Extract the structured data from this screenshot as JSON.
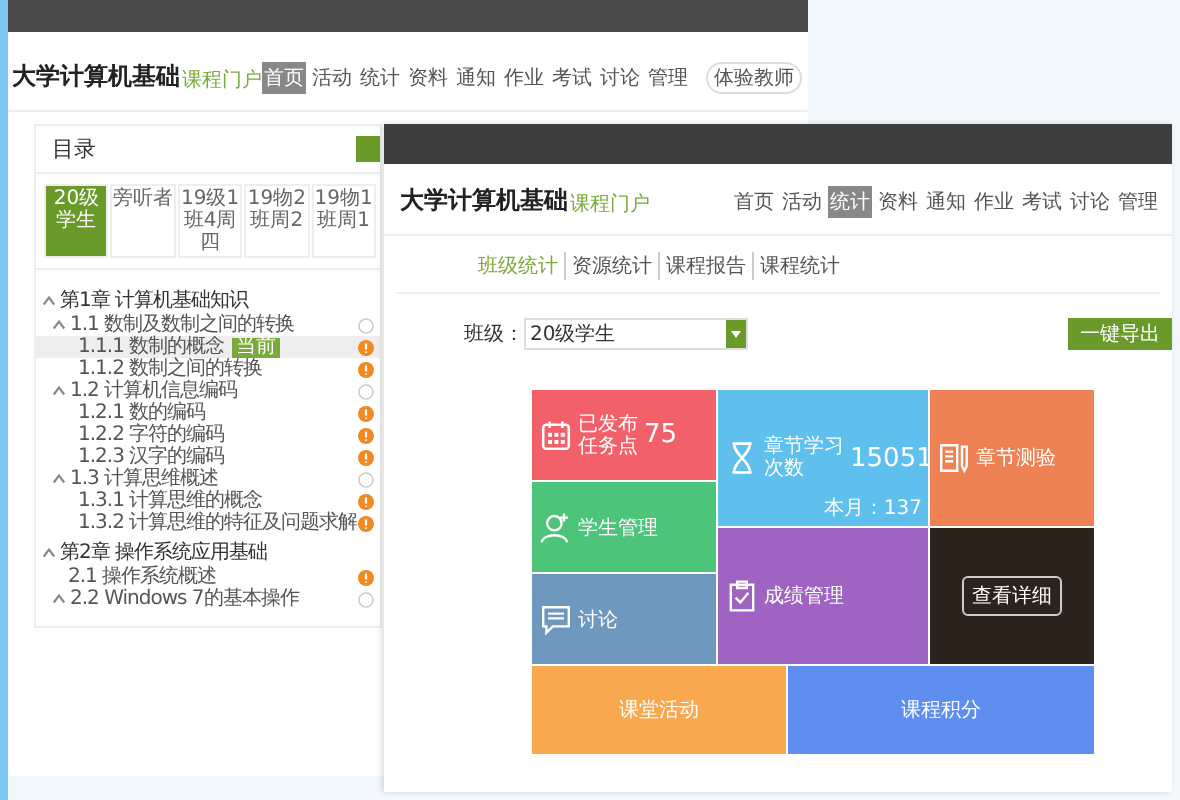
{
  "back_window": {
    "course_title": "大学计算机基础",
    "portal_label": "课程门户",
    "nav": [
      {
        "label": "首页",
        "selected": true
      },
      {
        "label": "活动",
        "selected": false
      },
      {
        "label": "统计",
        "selected": false
      },
      {
        "label": "资料",
        "selected": false
      },
      {
        "label": "通知",
        "selected": false
      },
      {
        "label": "作业",
        "selected": false
      },
      {
        "label": "考试",
        "selected": false
      },
      {
        "label": "讨论",
        "selected": false
      },
      {
        "label": "管理",
        "selected": false
      }
    ],
    "header_button": "体验教师",
    "catalog": {
      "title": "目录",
      "tabs": [
        {
          "label": "20级学生",
          "selected": true
        },
        {
          "label": "旁听者",
          "selected": false
        },
        {
          "label": "19级1班4周四",
          "selected": false
        },
        {
          "label": "19物2班周2",
          "selected": false
        },
        {
          "label": "19物1班周1",
          "selected": false
        }
      ],
      "tree": [
        {
          "label": "第1章 计算机基础知识",
          "expanded": true,
          "children": [
            {
              "label": "1.1 数制及数制之间的转换",
              "expanded": true,
              "task": false,
              "children": [
                {
                  "label": "1.1.1 数制的概念",
                  "selected": true,
                  "task": true,
                  "badge": "当前"
                },
                {
                  "label": "1.1.2 数制之间的转换",
                  "selected": false,
                  "task": true
                }
              ]
            },
            {
              "label": "1.2 计算机信息编码",
              "expanded": true,
              "task": false,
              "children": [
                {
                  "label": "1.2.1 数的编码",
                  "selected": false,
                  "task": true
                },
                {
                  "label": "1.2.2 字符的编码",
                  "selected": false,
                  "task": true
                },
                {
                  "label": "1.2.3 汉字的编码",
                  "selected": false,
                  "task": true
                }
              ]
            },
            {
              "label": "1.3 计算思维概述",
              "expanded": true,
              "task": false,
              "children": [
                {
                  "label": "1.3.1 计算思维的概念",
                  "selected": false,
                  "task": true
                },
                {
                  "label": "1.3.2 计算思维的特征及问题求解",
                  "selected": false,
                  "task": true
                }
              ]
            }
          ]
        },
        {
          "label": "第2章 操作系统应用基础",
          "expanded": true,
          "children": [
            {
              "label": "2.1 操作系统概述",
              "selected": false,
              "task": true
            },
            {
              "label": "2.2 Windows 7的基本操作",
              "expanded": true,
              "task": false
            }
          ]
        }
      ]
    }
  },
  "front_window": {
    "course_title": "大学计算机基础",
    "portal_label": "课程门户",
    "nav": [
      {
        "label": "首页",
        "selected": false
      },
      {
        "label": "活动",
        "selected": false
      },
      {
        "label": "统计",
        "selected": true
      },
      {
        "label": "资料",
        "selected": false
      },
      {
        "label": "通知",
        "selected": false
      },
      {
        "label": "作业",
        "selected": false
      },
      {
        "label": "考试",
        "selected": false
      },
      {
        "label": "讨论",
        "selected": false
      },
      {
        "label": "管理",
        "selected": false
      }
    ],
    "subtabs": [
      {
        "label": "班级统计",
        "selected": true
      },
      {
        "label": "资源统计",
        "selected": false
      },
      {
        "label": "课程报告",
        "selected": false
      },
      {
        "label": "课程统计",
        "selected": false
      }
    ],
    "class_select": {
      "label": "班级：",
      "value": "20级学生"
    },
    "export_button": "一键导出",
    "tiles": [
      {
        "kind": "stat",
        "color": "#f2616a",
        "label_lines": [
          "已发布",
          "任务点"
        ],
        "value": "75"
      },
      {
        "kind": "stat",
        "color": "#5fc0ee",
        "label_lines": [
          "章节学习",
          "次数"
        ],
        "value": "15051",
        "note": "本月：137"
      },
      {
        "kind": "link",
        "color": "#ef8255",
        "label": "章节测验"
      },
      {
        "kind": "link",
        "color": "#4cc47a",
        "label": "学生管理"
      },
      {
        "kind": "link",
        "color": "#6f98bf",
        "label": "讨论"
      },
      {
        "kind": "link",
        "color": "#9f63c2",
        "label": "成绩管理"
      },
      {
        "kind": "detail",
        "color": "#2c231c",
        "button": "查看详细"
      },
      {
        "kind": "bar",
        "color": "#f8a84e",
        "label": "课堂活动"
      },
      {
        "kind": "bar",
        "color": "#5e8ff0",
        "label": "课程积分"
      }
    ]
  }
}
